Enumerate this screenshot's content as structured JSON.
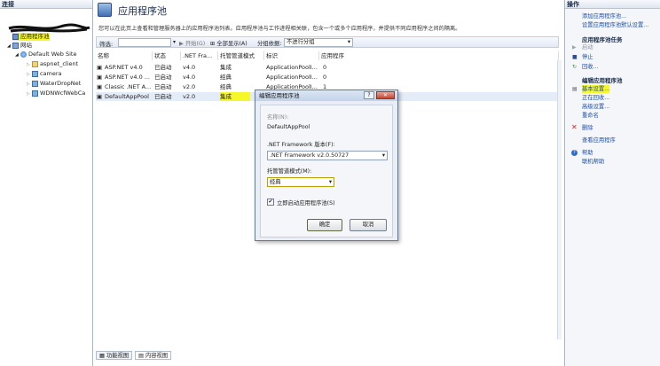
{
  "left": {
    "header": "连接",
    "items": [
      {
        "label": "应用程序池"
      },
      {
        "label": "网站"
      },
      {
        "label": "Default Web Site"
      },
      {
        "label": "aspnet_client"
      },
      {
        "label": "camera"
      },
      {
        "label": "WaterDropNet"
      },
      {
        "label": "WDNWcfWebCa"
      }
    ]
  },
  "main": {
    "title": "应用程序池",
    "description": "您可以在此页上查看和管理服务器上的应用程序池列表。应用程序池与工作进程相关联，包含一个或多个应用程序，并提供不同应用程序之间的隔离。",
    "filter_label": "筛选:",
    "start_label": "开始(G)",
    "show_all_label": "全部显示(A)",
    "group_label": "分组依据:",
    "group_value": "不进行分组",
    "columns": [
      "名称",
      "状态",
      ".NET Fra...",
      "托管管道模式",
      "标识",
      "应用程序"
    ],
    "rows": [
      {
        "name": "ASP.NET v4.0",
        "status": "已启动",
        "fw": "v4.0",
        "mode": "集成",
        "identity": "ApplicationPoolI...",
        "apps": "0"
      },
      {
        "name": "ASP.NET v4.0 ...",
        "status": "已启动",
        "fw": "v4.0",
        "mode": "经典",
        "identity": "ApplicationPoolI...",
        "apps": "0"
      },
      {
        "name": "Classic .NET A...",
        "status": "已启动",
        "fw": "v2.0",
        "mode": "经典",
        "identity": "ApplicationPoolI...",
        "apps": "1"
      },
      {
        "name": "DefaultAppPool",
        "status": "已启动",
        "fw": "v2.0",
        "mode": "集成",
        "identity": "",
        "apps": ""
      }
    ],
    "tab_features": "功能视图",
    "tab_content": "内容视图"
  },
  "dialog": {
    "title": "编辑应用程序池",
    "help": "?",
    "close": "✕",
    "name_label": "名称(N):",
    "name_value": "DefaultAppPool",
    "fw_label": ".NET Framework 版本(F):",
    "fw_value": ".NET Framework v2.0.50727",
    "mode_label": "托管管道模式(M):",
    "mode_value": "经典",
    "autostart_label": "立即启动应用程序池(S)",
    "ok": "确定",
    "cancel": "取消"
  },
  "actions": {
    "header": "操作",
    "add_pool": "添加应用程序池...",
    "set_defaults": "设置应用程序池默认设置...",
    "tasks_title": "应用程序池任务",
    "start": "启动",
    "stop": "停止",
    "recycle": "回收...",
    "edit_title": "编辑应用程序池",
    "basic_settings": "基本设置...",
    "recycling": "正在回收...",
    "advanced": "高级设置...",
    "rename": "重命名",
    "delete": "删除",
    "view_apps": "查看应用程序",
    "help": "帮助",
    "online_help": "联机帮助"
  },
  "colors": {
    "highlight": "#f5f72a",
    "link": "#1f4fa8",
    "accent": "#5f7aa3"
  }
}
